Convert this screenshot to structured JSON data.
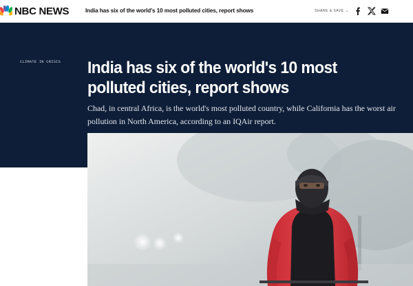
{
  "brand": {
    "name": "NBC NEWS",
    "peacock_colors": [
      "#f9a11b",
      "#ef3e42",
      "#6460aa",
      "#0089d0",
      "#0db14b",
      "#fcb711"
    ]
  },
  "topbar": {
    "headline": "India has six of the world's 10 most polluted cities, report shows",
    "share_label": "SHARE & SAVE",
    "share_chevron": "⌄",
    "social_icons": [
      "facebook-icon",
      "x-icon",
      "email-icon"
    ]
  },
  "article": {
    "eyebrow": "CLIMATE IN CRISIS",
    "headline": "India has six of the world's 10 most polluted cities, report shows",
    "dek": "Chad, in central Africa, is the world's most polluted country, while California has the worst air pollution in North America, according to an IQAir report."
  },
  "colors": {
    "hero_bg": "#0e1e38",
    "jacket_red": "#d8343d",
    "jacket_black": "#1a1a1c"
  }
}
